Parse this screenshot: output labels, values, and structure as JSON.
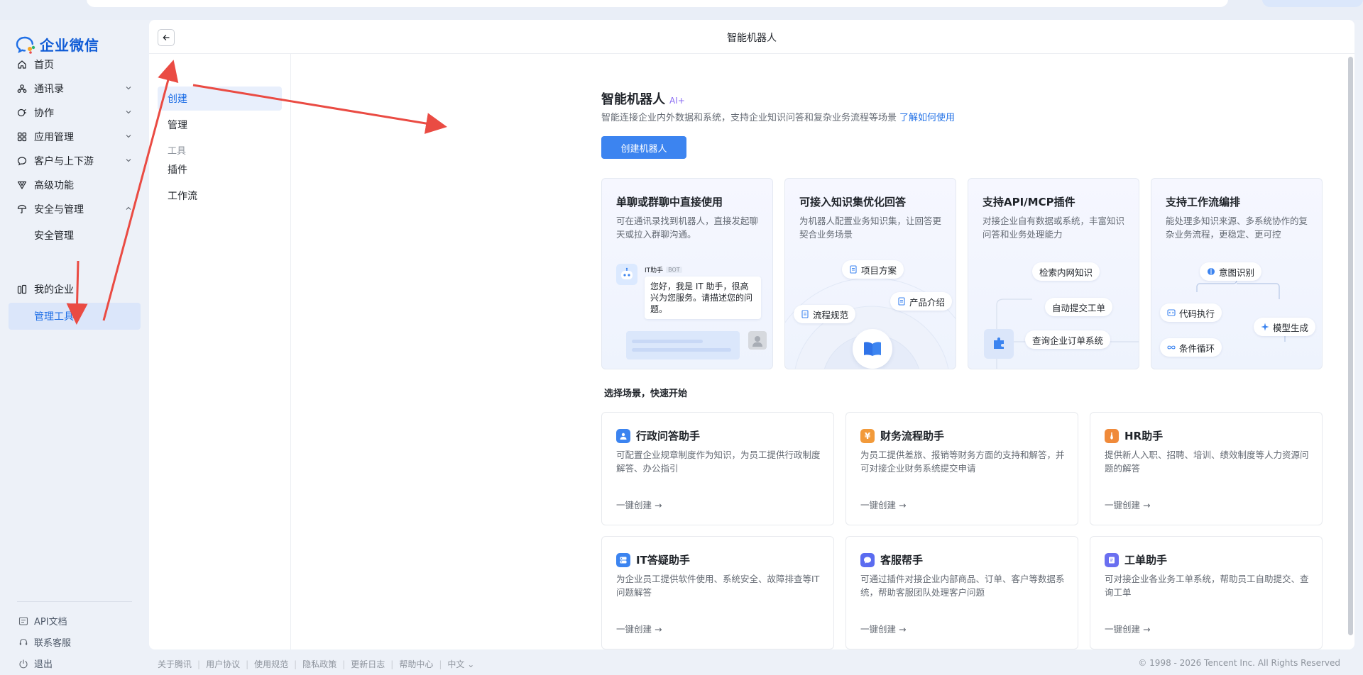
{
  "app": {
    "name": "企业微信"
  },
  "nav": {
    "items": [
      {
        "label": "首页",
        "icon": "home-icon",
        "chevron": false
      },
      {
        "label": "通讯录",
        "icon": "contacts-icon",
        "chevron": true
      },
      {
        "label": "协作",
        "icon": "collab-icon",
        "chevron": true
      },
      {
        "label": "应用管理",
        "icon": "apps-icon",
        "chevron": true
      },
      {
        "label": "客户与上下游",
        "icon": "chat-icon",
        "chevron": true
      },
      {
        "label": "高级功能",
        "icon": "advanced-icon",
        "chevron": false
      },
      {
        "label": "安全与管理",
        "icon": "security-icon",
        "chevron": "up"
      },
      {
        "label": "安全管理",
        "sub": true
      },
      {
        "label": "管理工具",
        "sub": true,
        "active": true
      },
      {
        "label": "我的企业",
        "icon": "company-icon",
        "chevron": false
      }
    ],
    "footer": [
      {
        "label": "API文档",
        "icon": "api-doc-icon"
      },
      {
        "label": "联系客服",
        "icon": "headset-icon"
      },
      {
        "label": "退出",
        "icon": "logout-icon"
      }
    ]
  },
  "header": {
    "title": "智能机器人"
  },
  "subnav": {
    "items": [
      {
        "label": "创建",
        "active": true
      },
      {
        "label": "管理"
      },
      {
        "label": "工具",
        "group": true
      },
      {
        "label": "插件"
      },
      {
        "label": "工作流"
      }
    ]
  },
  "main": {
    "title": "智能机器人",
    "ai_badge": "AI+",
    "description": "智能连接企业内外数据和系统，支持企业知识问答和复杂业务流程等场景",
    "learn_link": "了解如何使用",
    "create_button": "创建机器人",
    "features": [
      {
        "title": "单聊或群聊中直接使用",
        "desc": "可在通讯录找到机器人，直接发起聊天或拉入群聊沟通。"
      },
      {
        "title": "可接入知识集优化回答",
        "desc": "为机器人配置业务知识集，让回答更契合业务场景"
      },
      {
        "title": "支持API/MCP插件",
        "desc": "对接企业自有数据或系统，丰富知识问答和业务处理能力"
      },
      {
        "title": "支持工作流编排",
        "desc": "能处理多知识来源、多系统协作的复杂业务流程，更稳定、更可控"
      }
    ],
    "chat_demo": {
      "name": "IT助手",
      "bot_tag": "BOT",
      "message": "您好，我是 IT 助手，很高兴为您服务。请描述您的问题。"
    },
    "knowledge_chips": [
      "项目方案",
      "产品介绍",
      "流程规范"
    ],
    "plugin_chips": [
      "检索内网知识",
      "自动提交工单",
      "查询企业订单系统"
    ],
    "workflow_chips": [
      "意图识别",
      "代码执行",
      "模型生成",
      "条件循环"
    ],
    "section_title": "选择场景，快速开始",
    "templates": [
      {
        "title": "行政问答助手",
        "desc": "可配置企业规章制度作为知识，为员工提供行政制度解答、办公指引",
        "link": "一键创建",
        "color": "#3c84f0"
      },
      {
        "title": "财务流程助手",
        "desc": "为员工提供差旅、报销等财务方面的支持和解答，并可对接企业财务系统提交申请",
        "link": "一键创建",
        "color": "#f29a3a"
      },
      {
        "title": "HR助手",
        "desc": "提供新人入职、招聘、培训、绩效制度等人力资源问题的解答",
        "link": "一键创建",
        "color": "#f08a3a"
      },
      {
        "title": "IT答疑助手",
        "desc": "为企业员工提供软件使用、系统安全、故障排查等IT问题解答",
        "link": "一键创建",
        "color": "#3c84f0"
      },
      {
        "title": "客服帮手",
        "desc": "可通过插件对接企业内部商品、订单、客户等数据系统，帮助客服团队处理客户问题",
        "link": "一键创建",
        "color": "#5b6cf0"
      },
      {
        "title": "工单助手",
        "desc": "可对接企业各业务工单系统，帮助员工自助提交、查询工单",
        "link": "一键创建",
        "color": "#6a6ff0"
      }
    ]
  },
  "footer": {
    "links": [
      "关于腾讯",
      "用户协议",
      "使用规范",
      "隐私政策",
      "更新日志",
      "帮助中心",
      "中文"
    ],
    "copyright": "© 1998 - 2026 Tencent Inc. All Rights Reserved"
  },
  "colors": {
    "accent": "#3c84f0",
    "annotation": "#ea4b43"
  }
}
